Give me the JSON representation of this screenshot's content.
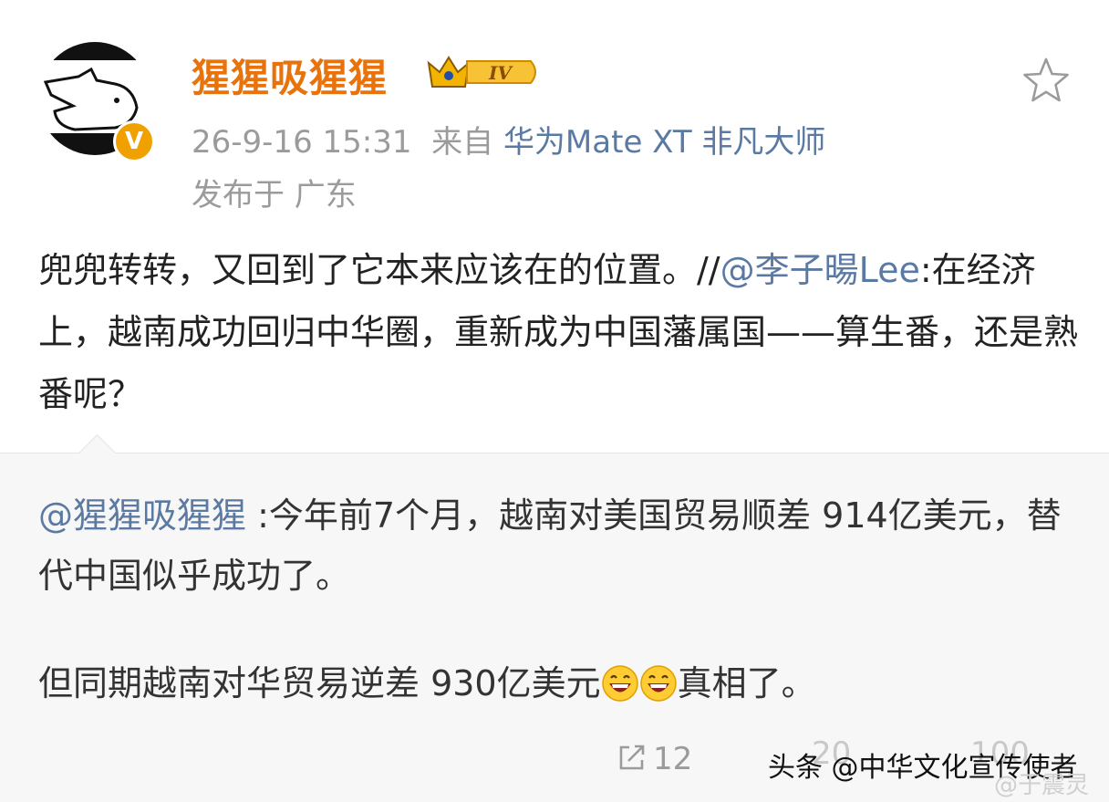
{
  "post": {
    "username": "猩猩吸猩猩",
    "level": "IV",
    "verified_mark": "V",
    "timestamp": "26-9-16 15:31",
    "source_prefix": "来自",
    "source_device": "华为Mate XT 非凡大师",
    "location": "发布于 广东",
    "text_main": "兜兜转转，又回到了它本来应该在的位置。//",
    "text_mention": "@李子暘Lee",
    "text_rest": ":在经济上，越南成功回归中华圈，重新成为中国藩属国——算生番，还是熟番呢？"
  },
  "quoted": {
    "mention": "@猩猩吸猩猩 ",
    "line1": ":今年前7个月，越南对美国贸易顺差 914亿美元，替代中国似乎成功了。",
    "line2_before": "但同期越南对华贸易逆差 930亿美元",
    "line2_after": "真相了。",
    "emoji": "grinning-face-icon"
  },
  "actions": {
    "repost_count": "12",
    "hidden_comment_count": "20",
    "hidden_like_count": "100"
  },
  "watermark": {
    "text": "头条 @中华文化宣传使者",
    "faint_text": "@于震灵"
  },
  "colors": {
    "username": "#e8720c",
    "link": "#5b7aa3",
    "meta": "#9b9b9b",
    "quote_bg": "#f7f7f7"
  }
}
